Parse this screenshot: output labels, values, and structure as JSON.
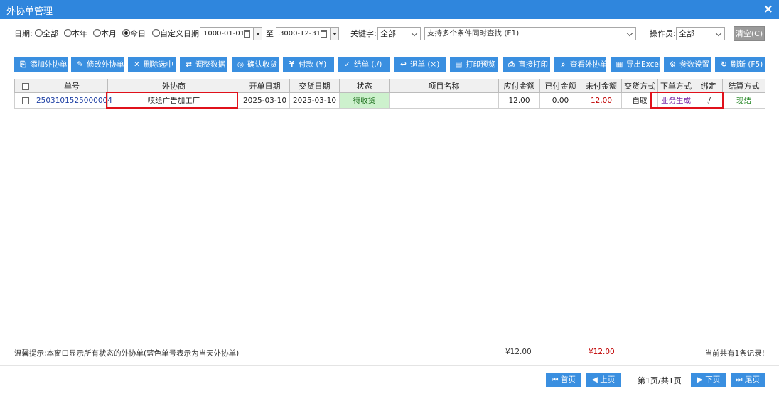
{
  "window": {
    "title": "外协单管理",
    "close_icon": "×"
  },
  "filters": {
    "date_label": "日期:",
    "date_options": [
      "全部",
      "本年",
      "本月",
      "今日",
      "自定义日期"
    ],
    "selected_date_option": "今日",
    "start_date": "1000-01-01",
    "to_label": "至",
    "end_date": "3000-12-31",
    "keyword_label": "关键字:",
    "keyword_field": "全部",
    "search_placeholder": "支持多个条件同时查找 (F1)",
    "operator_label": "操作员:",
    "operator": "全部",
    "clear_label": "清空(C)"
  },
  "toolbar": [
    {
      "icon": "⎘",
      "label": "添加外协单"
    },
    {
      "icon": "✎",
      "label": "修改外协单"
    },
    {
      "icon": "✕",
      "label": "删除选中"
    },
    {
      "icon": "⇄",
      "label": "调整数据"
    },
    {
      "icon": "◎",
      "label": "确认收货"
    },
    {
      "icon": "¥",
      "label": "付款 (¥)"
    },
    {
      "icon": "✓",
      "label": "结单 (./)"
    },
    {
      "icon": "↩",
      "label": "退单 (×)"
    },
    {
      "icon": "▤",
      "label": "打印预览"
    },
    {
      "icon": "⎙",
      "label": "直接打印"
    },
    {
      "icon": "⌕",
      "label": "查看外协单"
    },
    {
      "icon": "▦",
      "label": "导出Excel"
    },
    {
      "icon": "⚙",
      "label": "参数设置"
    },
    {
      "icon": "↻",
      "label": "刷新 (F5)"
    }
  ],
  "table": {
    "headers": [
      "单号",
      "外协商",
      "开单日期",
      "交货日期",
      "状态",
      "项目名称",
      "应付金额",
      "已付金额",
      "未付金额",
      "交货方式",
      "下单方式",
      "绑定",
      "结算方式"
    ],
    "rows": [
      {
        "order_no": "2503101525000004",
        "vendor": "喷绘广告加工厂",
        "open_date": "2025-03-10",
        "delivery_date": "2025-03-10",
        "status": "待收货",
        "project": "",
        "payable": "12.00",
        "paid": "0.00",
        "unpaid": "12.00",
        "delivery_method": "自取",
        "order_method": "业务生成",
        "bound": "./",
        "settlement": "现结"
      }
    ]
  },
  "footer": {
    "hint": "温馨提示:本窗口显示所有状态的外协单(蓝色单号表示为当天外协单)",
    "sum_payable": "¥12.00",
    "sum_unpaid": "¥12.00",
    "total_records": "当前共有1条记录!"
  },
  "pager": {
    "first": "首页",
    "prev": "上页",
    "info": "第1页/共1页",
    "next": "下页",
    "last": "尾页"
  },
  "colors": {
    "titlebar": "#2f86dd",
    "button": "#3a8fe0",
    "highlight": "#e0111b",
    "status_bg": "#cdf1cd"
  }
}
